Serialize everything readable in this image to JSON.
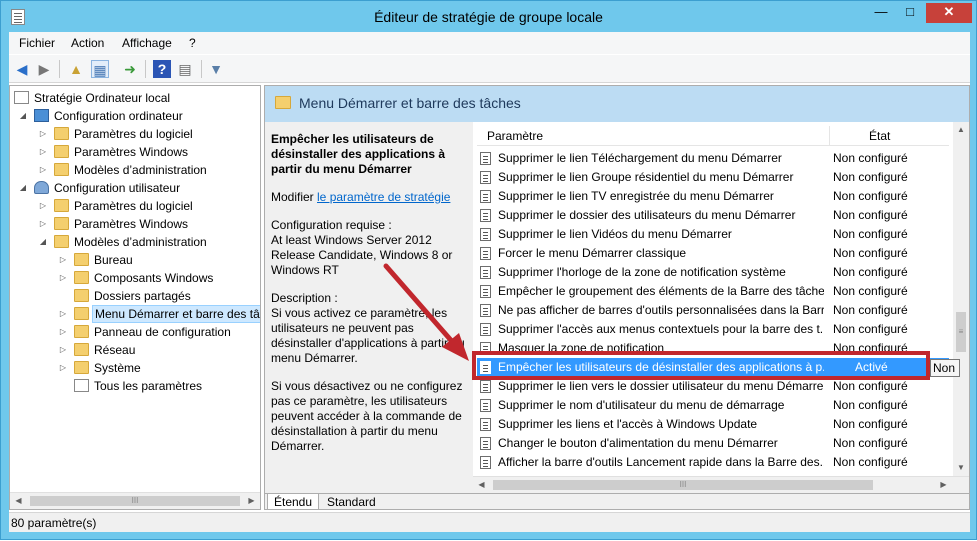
{
  "window": {
    "title": "Éditeur de stratégie de groupe locale",
    "controls": {
      "minimize": "—",
      "maximize": "□",
      "close": "✕"
    }
  },
  "menubar": [
    "Fichier",
    "Action",
    "Affichage",
    "?"
  ],
  "toolbar": [
    "back-arrow-icon",
    "forward-arrow-icon",
    "up-folder-icon",
    "show-hide-tree-icon",
    "export-list-icon",
    "help-icon",
    "properties-icon",
    "filter-icon"
  ],
  "tree": [
    {
      "label": "Stratégie Ordinateur local",
      "icon": "doc-icon"
    },
    {
      "label": "Configuration ordinateur",
      "icon": "computer-icon"
    },
    {
      "label": "Paramètres du logiciel",
      "icon": "folder-icon"
    },
    {
      "label": "Paramètres Windows",
      "icon": "folder-icon"
    },
    {
      "label": "Modèles d’administration",
      "icon": "folder-icon"
    },
    {
      "label": "Configuration utilisateur",
      "icon": "user-icon"
    },
    {
      "label": "Paramètres du logiciel",
      "icon": "folder-icon"
    },
    {
      "label": "Paramètres Windows",
      "icon": "folder-icon"
    },
    {
      "label": "Modèles d’administration",
      "icon": "folder-icon"
    },
    {
      "label": "Bureau",
      "icon": "folder-icon"
    },
    {
      "label": "Composants Windows",
      "icon": "folder-icon"
    },
    {
      "label": "Dossiers partagés",
      "icon": "folder-icon"
    },
    {
      "label": "Menu Démarrer et barre des tâches",
      "icon": "folder-icon"
    },
    {
      "label": "Panneau de configuration",
      "icon": "folder-icon"
    },
    {
      "label": "Réseau",
      "icon": "folder-icon"
    },
    {
      "label": "Système",
      "icon": "folder-icon"
    },
    {
      "label": "Tous les paramètres",
      "icon": "all-settings-icon"
    }
  ],
  "content_header": "Menu Démarrer et barre des tâches",
  "description": {
    "title": "Empêcher les utilisateurs de désinstaller des applications à partir du menu Démarrer",
    "edit_prefix": "Modifier ",
    "edit_link": "le paramètre de stratégie",
    "requirements_label": "Configuration requise :",
    "requirements": "At least Windows Server 2012 Release Candidate, Windows 8 or Windows RT",
    "description_label": "Description :",
    "description_p1": "Si vous activez ce paramètre, les utilisateurs ne peuvent pas désinstaller d'applications à partir du menu Démarrer.",
    "description_p2": "Si vous désactivez ou ne configurez pas ce paramètre, les utilisateurs peuvent accéder à la commande de désinstallation à partir du menu Démarrer."
  },
  "list": {
    "col_name": "Paramètre",
    "col_state": "État",
    "rows": [
      {
        "name": "Supprimer le lien Téléchargement du menu Démarrer",
        "state": "Non configuré"
      },
      {
        "name": "Supprimer le lien Groupe résidentiel du menu Démarrer",
        "state": "Non configuré"
      },
      {
        "name": "Supprimer le lien TV enregistrée du menu Démarrer",
        "state": "Non configuré"
      },
      {
        "name": "Supprimer le dossier des utilisateurs du menu Démarrer",
        "state": "Non configuré"
      },
      {
        "name": "Supprimer le lien Vidéos du menu Démarrer",
        "state": "Non configuré"
      },
      {
        "name": "Forcer le menu Démarrer classique",
        "state": "Non configuré"
      },
      {
        "name": "Supprimer l'horloge de la zone de notification système",
        "state": "Non configuré"
      },
      {
        "name": "Empêcher le groupement des éléments de la Barre des tâches",
        "state": "Non configuré"
      },
      {
        "name": "Ne pas afficher de barres d'outils personnalisées dans la Barr...",
        "state": "Non configuré"
      },
      {
        "name": "Supprimer l'accès aux menus contextuels pour la barre des t...",
        "state": "Non configuré"
      },
      {
        "name": "Masquer la zone de notification",
        "state": "Non configuré"
      },
      {
        "name": "Empêcher les utilisateurs de désinstaller des applications à p...",
        "state": "Activé"
      },
      {
        "name": "Supprimer le lien vers le dossier utilisateur du menu Démarrer",
        "state": "Non configuré"
      },
      {
        "name": "Supprimer le nom d'utilisateur du menu de démarrage",
        "state": "Non configuré"
      },
      {
        "name": "Supprimer les liens et l'accès à Windows Update",
        "state": "Non configuré"
      },
      {
        "name": "Changer le bouton d'alimentation du menu Démarrer",
        "state": "Non configuré"
      },
      {
        "name": "Afficher la barre d'outils Lancement rapide dans la Barre des...",
        "state": "Non configuré"
      }
    ],
    "highlighted_index": 11
  },
  "tooltip": "Non",
  "tabs": [
    "Étendu",
    "Standard"
  ],
  "status": "80 paramètre(s)",
  "colors": {
    "highlight": "#3399ff",
    "annotation": "#c1272d",
    "header": "#bcdcf3",
    "window": "#6fc8ec"
  }
}
